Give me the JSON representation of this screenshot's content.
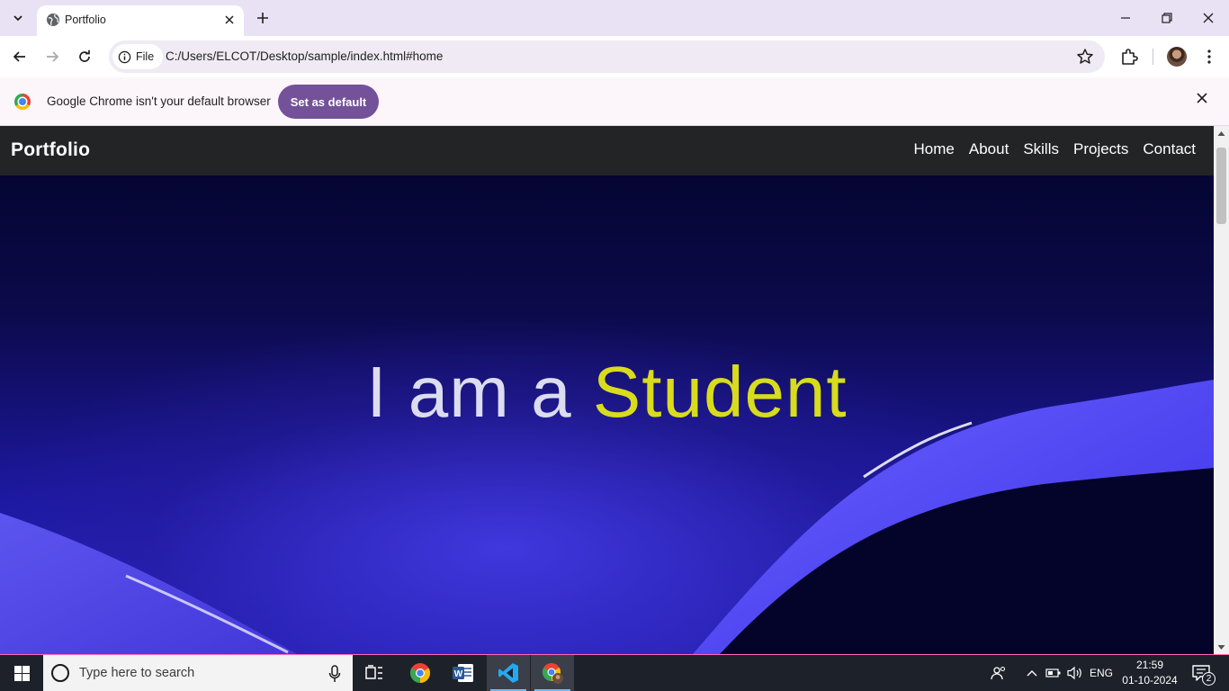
{
  "browser": {
    "tab_title": "Portfolio",
    "url_chip_label": "File",
    "url": "C:/Users/ELCOT/Desktop/sample/index.html#home",
    "infobar_text": "Google Chrome isn't your default browser",
    "infobar_button": "Set as default"
  },
  "site": {
    "brand": "Portfolio",
    "nav": [
      "Home",
      "About",
      "Skills",
      "Projects",
      "Contact"
    ],
    "headline_lead": "I am a ",
    "headline_accent": "Student",
    "accent_color": "#d8dc1c"
  },
  "taskbar": {
    "search_placeholder": "Type here to search",
    "language": "ENG",
    "time": "21:59",
    "date": "01-10-2024",
    "notification_count": "2"
  }
}
